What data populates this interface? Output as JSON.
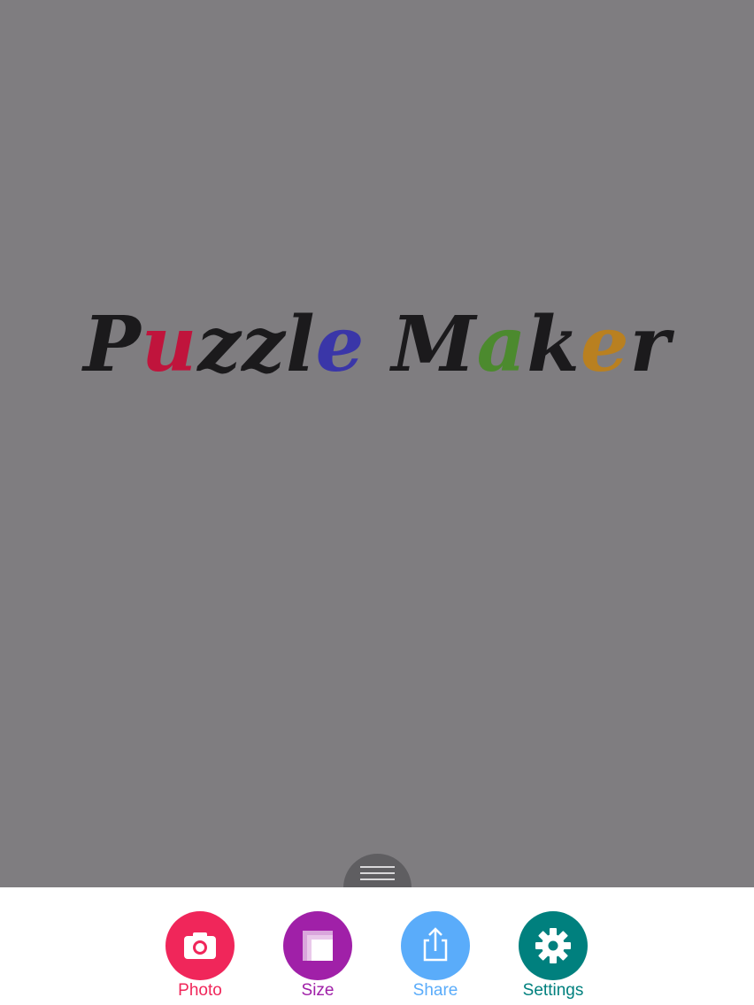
{
  "logo": {
    "letters": [
      {
        "ch": "P",
        "color": "#1b1a1c"
      },
      {
        "ch": "u",
        "color": "#c0143c"
      },
      {
        "ch": "z",
        "color": "#1b1a1c"
      },
      {
        "ch": "z",
        "color": "#1b1a1c"
      },
      {
        "ch": "l",
        "color": "#1b1a1c"
      },
      {
        "ch": "e",
        "color": "#3a36a8"
      },
      {
        "ch": "M",
        "color": "#1b1a1c"
      },
      {
        "ch": "a",
        "color": "#4c8a2e"
      },
      {
        "ch": "k",
        "color": "#1b1a1c"
      },
      {
        "ch": "e",
        "color": "#b98020"
      },
      {
        "ch": "r",
        "color": "#1b1a1c"
      }
    ]
  },
  "toolbar": {
    "photo": {
      "label": "Photo",
      "color": "#f0265a",
      "icon": "camera-icon"
    },
    "size": {
      "label": "Size",
      "color": "#a020a8",
      "icon": "size-frames-icon"
    },
    "share": {
      "label": "Share",
      "color": "#5aacfa",
      "icon": "share-icon"
    },
    "settings": {
      "label": "Settings",
      "color": "#00807e",
      "icon": "gear-icon"
    }
  },
  "drawer_handle": {
    "icon": "menu-lines-icon"
  }
}
